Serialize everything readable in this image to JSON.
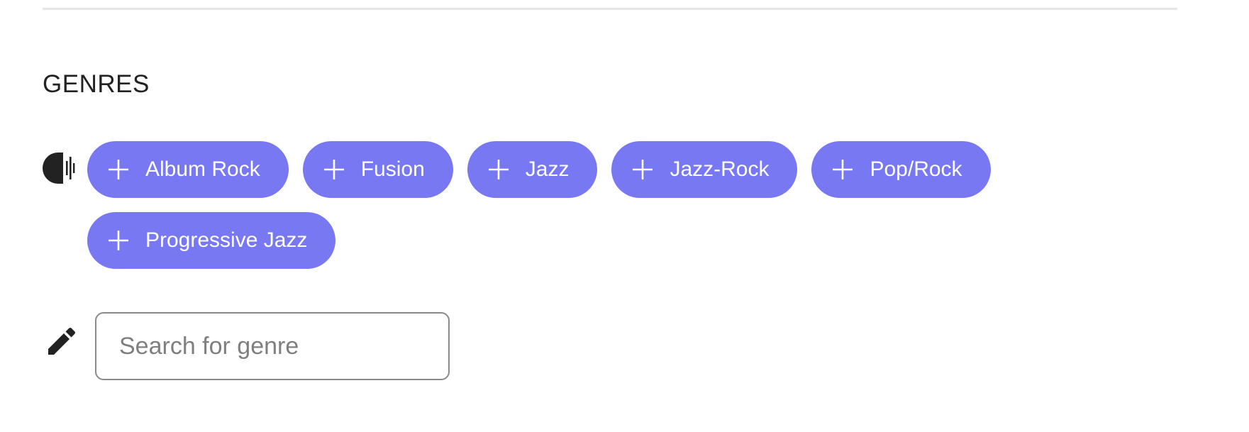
{
  "section": {
    "title": "GENRES"
  },
  "icons": {
    "genre": "genre-waveform-icon",
    "plus": "plus-icon",
    "edit": "pencil-icon"
  },
  "colors": {
    "tag_background": "#7878f2",
    "tag_text": "#ffffff",
    "divider": "#e6e6e6",
    "input_border": "#8a8a8a"
  },
  "genres": [
    {
      "label": "Album Rock"
    },
    {
      "label": "Fusion"
    },
    {
      "label": "Jazz"
    },
    {
      "label": "Jazz-Rock"
    },
    {
      "label": "Pop/Rock"
    },
    {
      "label": "Progressive Jazz"
    }
  ],
  "search": {
    "placeholder": "Search for genre",
    "value": ""
  }
}
